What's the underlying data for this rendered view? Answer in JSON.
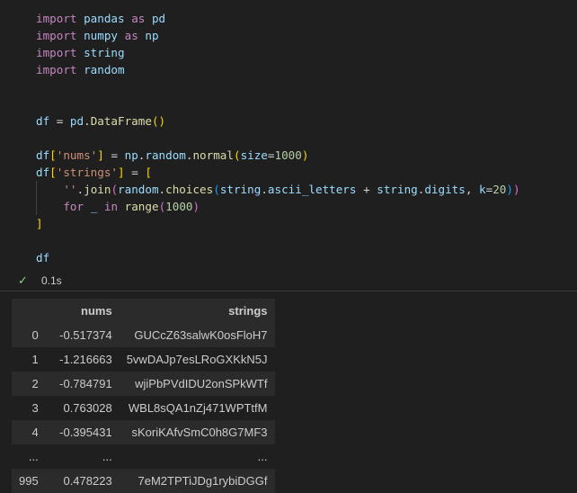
{
  "code_lines": {
    "l1": {
      "kw": "import",
      "mod": "pandas",
      "as": "as",
      "alias": "pd"
    },
    "l2": {
      "kw": "import",
      "mod": "numpy",
      "as": "as",
      "alias": "np"
    },
    "l3": {
      "kw": "import",
      "mod": "string"
    },
    "l4": {
      "kw": "import",
      "mod": "random"
    },
    "l5": {
      "var": "df",
      "eq": " = ",
      "obj": "pd",
      "dot": ".",
      "fn": "DataFrame",
      "paren": "()"
    },
    "l6": {
      "var": "df",
      "b1": "[",
      "key": "'nums'",
      "b2": "]",
      "eq": " = ",
      "obj1": "np",
      "dot1": ".",
      "obj2": "random",
      "dot2": ".",
      "fn": "normal",
      "p1": "(",
      "arg": "size",
      "eqs": "=",
      "num": "1000",
      "p2": ")"
    },
    "l7": {
      "var": "df",
      "b1": "[",
      "key": "'strings'",
      "b2": "]",
      "eq": " = ",
      "b3": "["
    },
    "l8": {
      "str": "''",
      "dot": ".",
      "fn": "join",
      "p1": "(",
      "obj": "random",
      "dot2": ".",
      "fn2": "choices",
      "p2": "(",
      "mod": "string",
      "dot3": ".",
      "attr": "ascii_letters",
      "plus": " + ",
      "mod2": "string",
      "dot4": ".",
      "attr2": "digits",
      "comma": ", ",
      "arg": "k",
      "eqs": "=",
      "num": "20",
      "p3": ")",
      "p4": ")"
    },
    "l9": {
      "for": "for",
      "under": "_",
      "in": "in",
      "fn": "range",
      "p1": "(",
      "num": "1000",
      "p2": ")"
    },
    "l10": {
      "b": "]"
    },
    "l11": {
      "var": "df"
    }
  },
  "status": {
    "check_icon": "✓",
    "time": "0.1s"
  },
  "table": {
    "headers": [
      "",
      "nums",
      "strings"
    ],
    "rows": [
      [
        "0",
        "-0.517374",
        "GUCcZ63salwK0osFloH7"
      ],
      [
        "1",
        "-1.216663",
        "5vwDAJp7esLRoGXKkN5J"
      ],
      [
        "2",
        "-0.784791",
        "wjiPbPVdIDU2onSPkWTf"
      ],
      [
        "3",
        "0.763028",
        "WBL8sQA1nZj471WPTtfM"
      ],
      [
        "4",
        "-0.395431",
        "sKoriKAfvSmC0h8G7MF3"
      ],
      [
        "...",
        "...",
        "..."
      ],
      [
        "995",
        "0.478223",
        "7eM2TPTiJDg1rybiDGGf"
      ]
    ]
  }
}
